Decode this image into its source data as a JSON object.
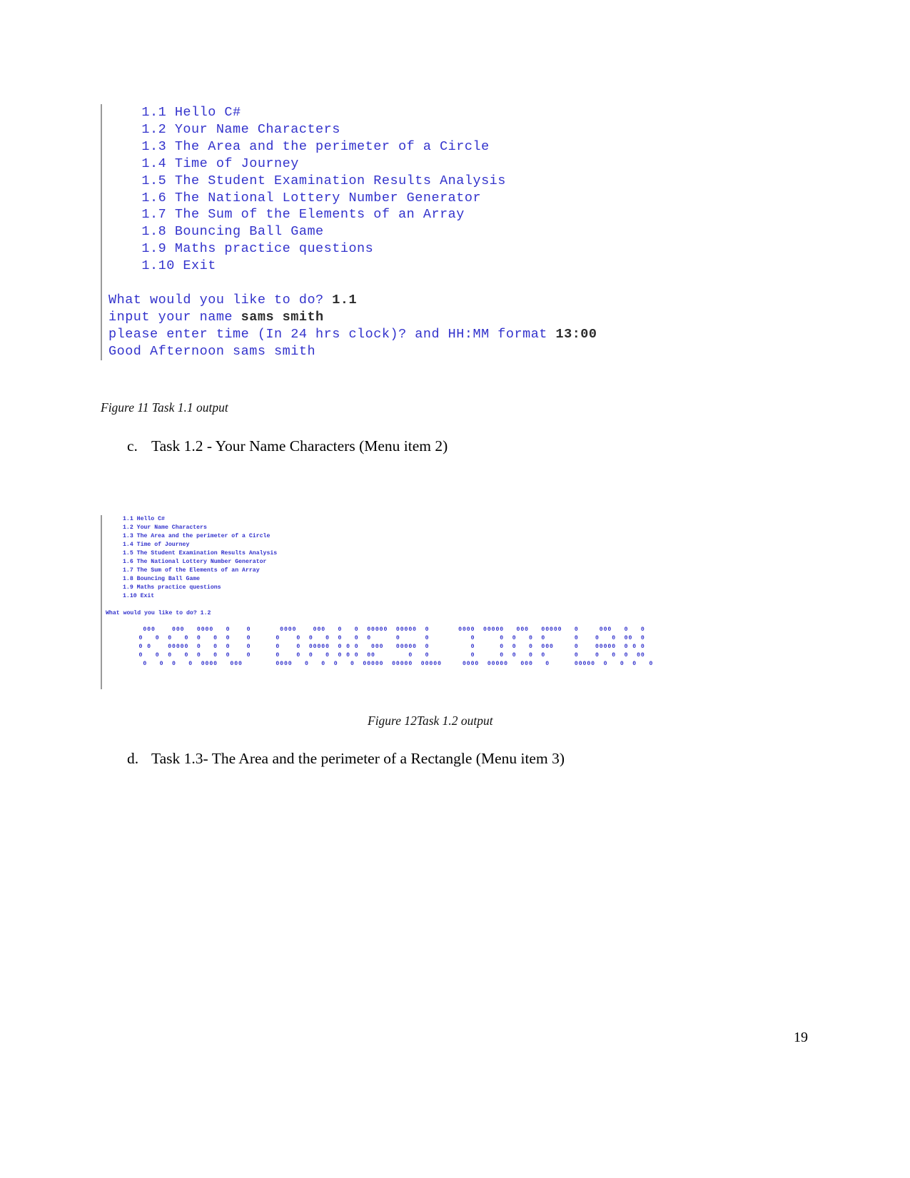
{
  "document": {
    "page_number": "19"
  },
  "figure_1": {
    "console_lines": [
      "    1.1 Hello C#",
      "    1.2 Your Name Characters",
      "    1.3 The Area and the perimeter of a Circle",
      "    1.4 Time of Journey",
      "    1.5 The Student Examination Results Analysis",
      "    1.6 The National Lottery Number Generator",
      "    1.7 The Sum of the Elements of an Array",
      "    1.8 Bouncing Ball Game",
      "    1.9 Maths practice questions",
      "    1.10 Exit",
      "",
      "What would you like to do? 1.1",
      "input your name sams smith",
      "please enter time (In 24 hrs clock)? and HH:MM format 13:00",
      "Good Afternoon sams smith"
    ],
    "prompt_1_text": "What would you like to do? ",
    "prompt_1_input": "1.1",
    "prompt_2_text": "input your name ",
    "prompt_2_input": "sams smith",
    "prompt_3_text": "please enter time (In 24 hrs clock)? and HH:MM format ",
    "prompt_3_input": "13:00",
    "greeting_line": "Good Afternoon sams smith",
    "caption": "Figure 11 Task 1.1 output"
  },
  "heading_c": {
    "marker": "c.",
    "text": "Task 1.2 - Your Name Characters (Menu item 2)"
  },
  "figure_2": {
    "menu_lines": [
      "1.1 Hello C#",
      "1.2 Your Name Characters",
      "1.3 The Area and the perimeter of a Circle",
      "1.4 Time of Journey",
      "1.5 The Student Examination Results Analysis",
      "1.6 The National Lottery Number Generator",
      "1.7 The Sum of the Elements of an Array",
      "1.8 Bouncing Ball Game",
      "1.9 Maths practice questions",
      "1.10 Exit"
    ],
    "prompt_text": "What would you like to do? ",
    "prompt_input": "1.2",
    "banner_lines": [
      "         000    000   0000   0    0       0000    000   0   0  00000  00000  0       0000  00000   000   00000   0     000   0   0",
      "        0   0  0   0  0   0  0    0      0    0  0   0  0   0  0      0      0          0      0  0   0  0       0    0   0  00  0",
      "        0 0    00000  0   0  0    0      0    0  00000  0 0 0   000   00000  0          0      0  0   0  000     0    00000  0 0 0",
      "        0   0  0   0  0   0  0    0      0    0  0   0  0 0 0  00        0   0          0      0  0   0  0       0    0   0  0  00",
      "         0   0  0   0  0000   000        0000   0   0  0   0  00000  00000  00000     0000  00000   000   0      00000  0   0  0   0"
    ],
    "banner_word": "SAMS SMITH",
    "caption": "Figure 12Task 1.2 output"
  },
  "heading_d": {
    "marker": "d.",
    "text": "Task 1.3- The Area and the perimeter of a Rectangle (Menu item 3)"
  },
  "colors": {
    "console_text": "#3333cc",
    "user_input": "#2b2b2b",
    "border": "#9a9a9a"
  }
}
